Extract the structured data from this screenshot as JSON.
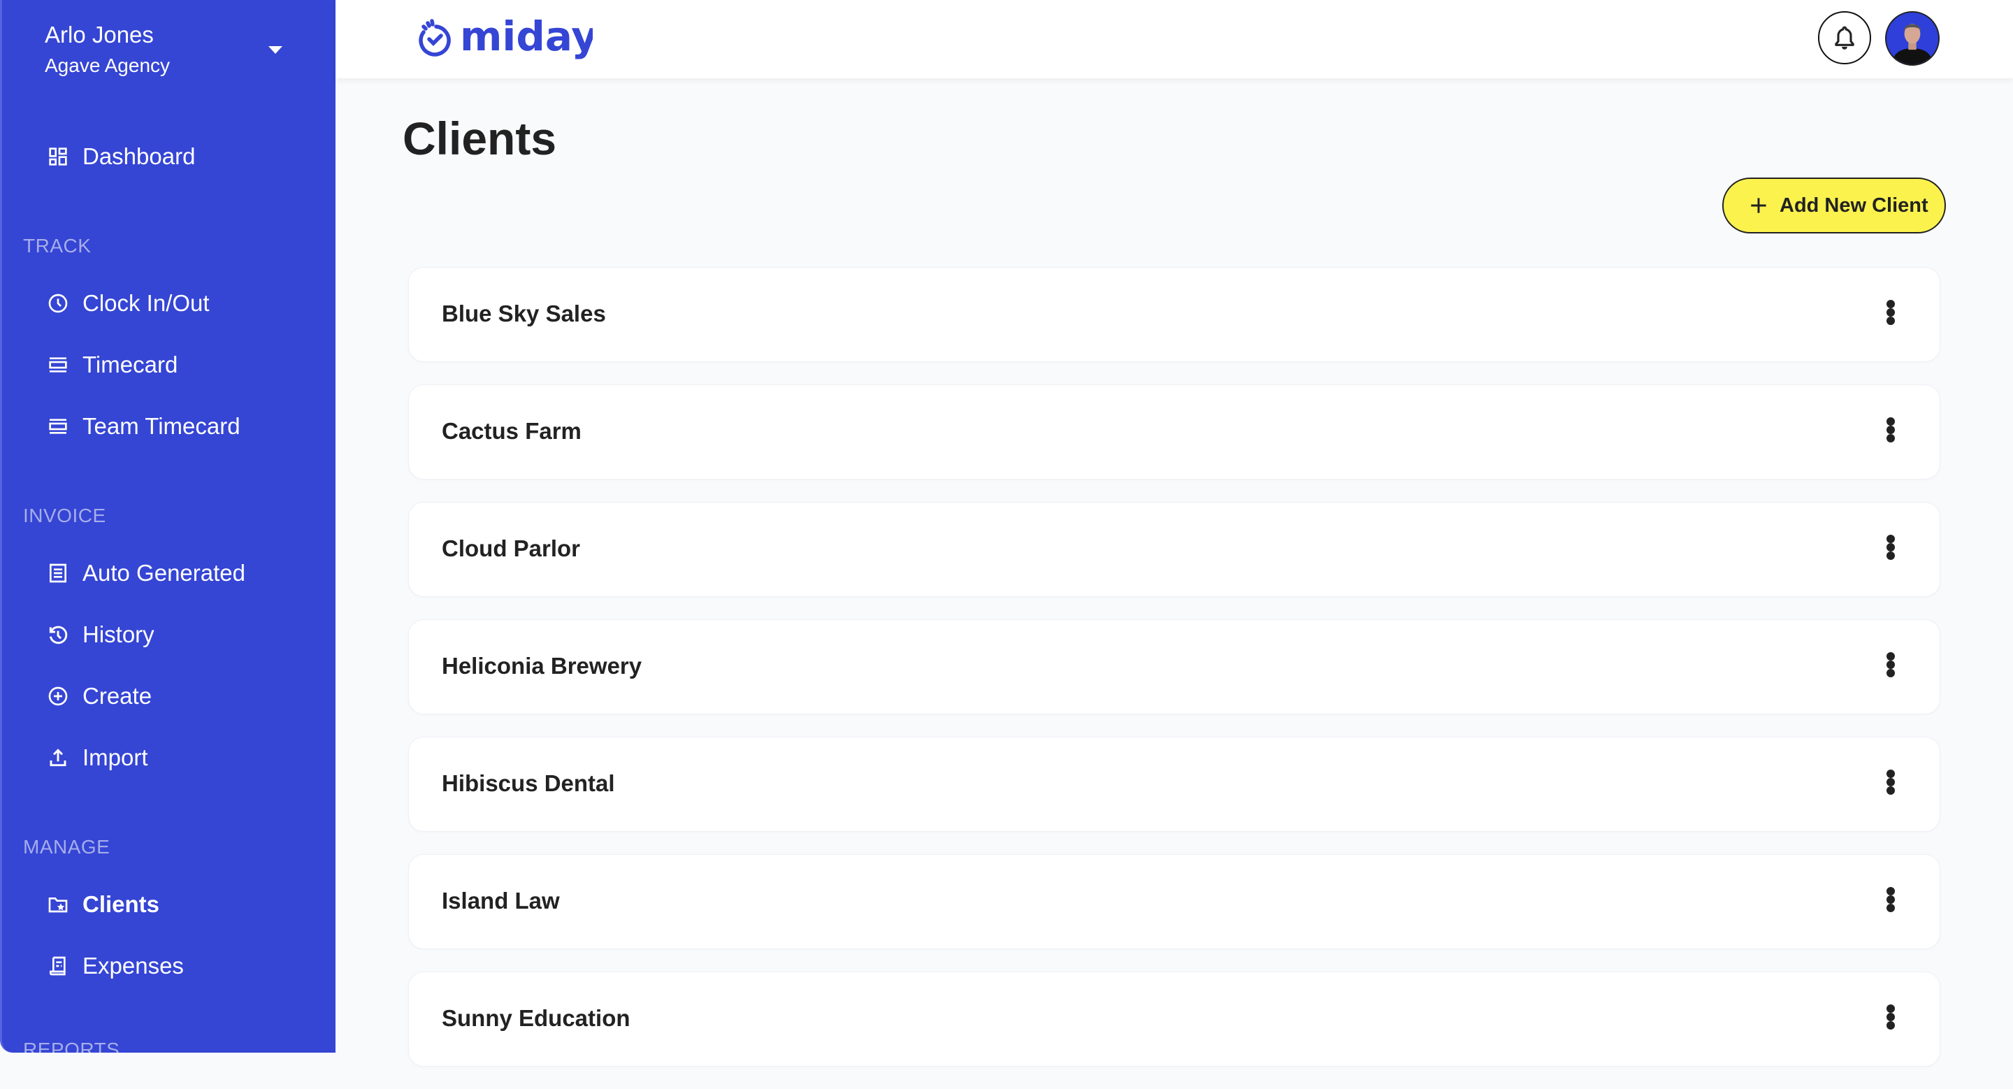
{
  "user": {
    "name": "Arlo Jones",
    "organization": "Agave Agency"
  },
  "sidebar": {
    "dashboard": {
      "label": "Dashboard",
      "icon": "dashboard-icon"
    },
    "sections": [
      {
        "label": "TRACK",
        "items": [
          {
            "label": "Clock In/Out",
            "icon": "clock-icon"
          },
          {
            "label": "Timecard",
            "icon": "timecard-icon"
          },
          {
            "label": "Team Timecard",
            "icon": "timecard-icon"
          }
        ]
      },
      {
        "label": "INVOICE",
        "items": [
          {
            "label": "Auto Generated",
            "icon": "receipt-icon"
          },
          {
            "label": "History",
            "icon": "history-icon"
          },
          {
            "label": "Create",
            "icon": "plus-circle-icon"
          },
          {
            "label": "Import",
            "icon": "upload-icon"
          }
        ]
      },
      {
        "label": "MANAGE",
        "items": [
          {
            "label": "Clients",
            "icon": "folder-star-icon",
            "active": true
          },
          {
            "label": "Expenses",
            "icon": "expense-receipt-icon"
          }
        ]
      },
      {
        "label": "REPORTS",
        "items": []
      }
    ]
  },
  "header": {
    "logo_text": "miday",
    "brand_color": "#3545d4"
  },
  "main": {
    "title": "Clients",
    "add_button_label": "Add New Client",
    "clients": [
      {
        "name": "Blue Sky Sales"
      },
      {
        "name": "Cactus Farm"
      },
      {
        "name": "Cloud Parlor"
      },
      {
        "name": "Heliconia Brewery"
      },
      {
        "name": "Hibiscus Dental"
      },
      {
        "name": "Island Law"
      },
      {
        "name": "Sunny Education"
      }
    ]
  },
  "colors": {
    "sidebar": "#3545d4",
    "accent_button": "#fbf24e",
    "page_bg": "#f9fafc",
    "text": "#222222",
    "section_label": "#a6adeb"
  }
}
